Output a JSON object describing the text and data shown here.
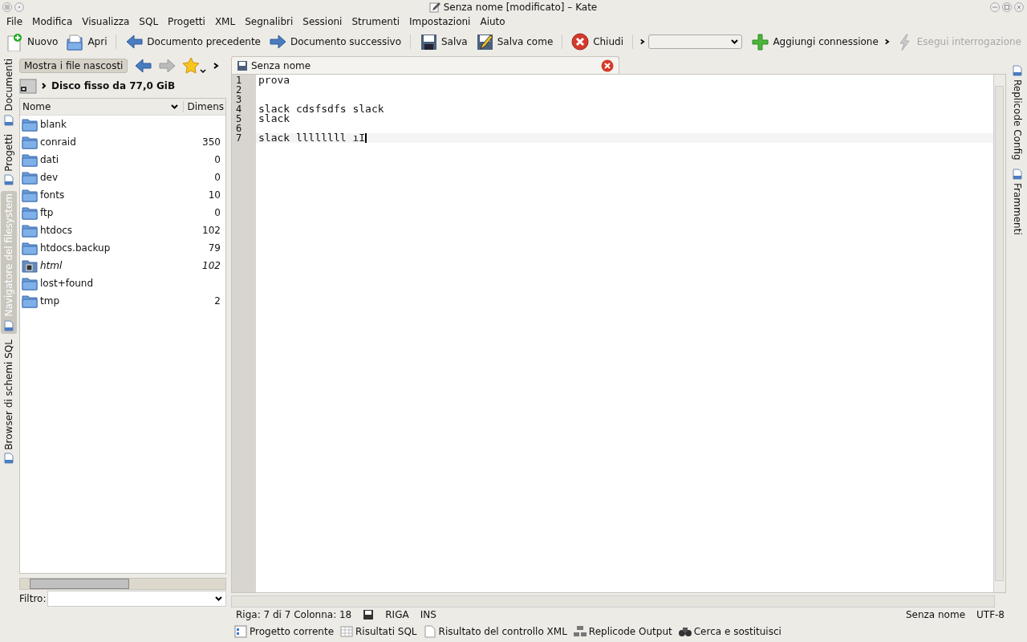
{
  "window": {
    "title": "Senza nome [modificato] – Kate"
  },
  "menu": [
    "File",
    "Modifica",
    "Visualizza",
    "SQL",
    "Progetti",
    "XML",
    "Segnalibri",
    "Sessioni",
    "Strumenti",
    "Impostazioni",
    "Aiuto"
  ],
  "toolbar": [
    {
      "kind": "button",
      "label": "Nuovo",
      "disabled": false
    },
    {
      "kind": "button",
      "label": "Apri",
      "disabled": false
    },
    {
      "kind": "separator"
    },
    {
      "kind": "button",
      "label": "Documento precedente",
      "disabled": false
    },
    {
      "kind": "button",
      "label": "Documento successivo",
      "disabled": false
    },
    {
      "kind": "separator"
    },
    {
      "kind": "button",
      "label": "Salva",
      "disabled": false
    },
    {
      "kind": "button",
      "label": "Salva come",
      "disabled": false
    },
    {
      "kind": "separator"
    },
    {
      "kind": "button",
      "label": "Chiudi",
      "disabled": false
    },
    {
      "kind": "separator"
    },
    {
      "kind": "chevron"
    },
    {
      "kind": "combo"
    },
    {
      "kind": "button",
      "label": "Aggiungi connessione",
      "disabled": false
    },
    {
      "kind": "chevron"
    },
    {
      "kind": "button",
      "label": "Esegui interrogazione",
      "disabled": true
    }
  ],
  "left_tabs": [
    {
      "label": "Documenti",
      "selected": false
    },
    {
      "label": "Progetti",
      "selected": false
    },
    {
      "label": "Navigatore del filesystem",
      "selected": true
    },
    {
      "label": "Browser di schemi SQL",
      "selected": false
    }
  ],
  "file_browser": {
    "hidden_files_button": "Mostra i file nascosti",
    "location": "Disco fisso da 77,0 GiB",
    "columns": [
      "Nome",
      "Dimens"
    ],
    "rows": [
      {
        "kind": "folder",
        "name": "blank"
      },
      {
        "kind": "folder",
        "name": "conraid",
        "size": "350"
      },
      {
        "kind": "folder",
        "name": "dati",
        "size": "0"
      },
      {
        "kind": "folder",
        "name": "dev",
        "size": "0"
      },
      {
        "kind": "folder",
        "name": "fonts",
        "size": "10"
      },
      {
        "kind": "folder",
        "name": "ftp",
        "size": "0"
      },
      {
        "kind": "folder",
        "name": "htdocs",
        "size": "102"
      },
      {
        "kind": "folder",
        "name": "htdocs.backup",
        "size": "79"
      },
      {
        "kind": "link",
        "name": "html",
        "size": "102"
      },
      {
        "kind": "folder",
        "name": "lost+found"
      },
      {
        "kind": "folder",
        "name": "tmp",
        "size": "2"
      }
    ],
    "filter_label": "Filtro:"
  },
  "editor": {
    "tab": "Senza nome",
    "lines": [
      {
        "number": "1",
        "text": "prova",
        "current": false
      },
      {
        "number": "2",
        "current": false
      },
      {
        "number": "3",
        "current": false
      },
      {
        "number": "4",
        "text": "slack cdsfsdfs slack",
        "current": false
      },
      {
        "number": "5",
        "text": "slack",
        "current": false
      },
      {
        "number": "6",
        "current": false
      },
      {
        "number": "7",
        "text": "slack llllllll ıI",
        "current": true
      }
    ]
  },
  "right_tabs": [
    {
      "label": "Replicode Config",
      "selected": false
    },
    {
      "label": "Frammenti",
      "selected": false
    }
  ],
  "status_bar": {
    "position": "Riga: 7 di 7 Colonna: 18",
    "line_mode": "RIGA",
    "insert_mode": "INS",
    "document": "Senza nome",
    "encoding": "UTF-8"
  },
  "bottom_tabs": [
    {
      "label": "Progetto corrente",
      "selected": false
    },
    {
      "label": "Risultati SQL",
      "selected": false
    },
    {
      "label": "Risultato del controllo XML",
      "selected": false
    },
    {
      "label": "Replicode Output",
      "selected": false
    },
    {
      "label": "Cerca e sostituisci",
      "selected": false
    }
  ]
}
